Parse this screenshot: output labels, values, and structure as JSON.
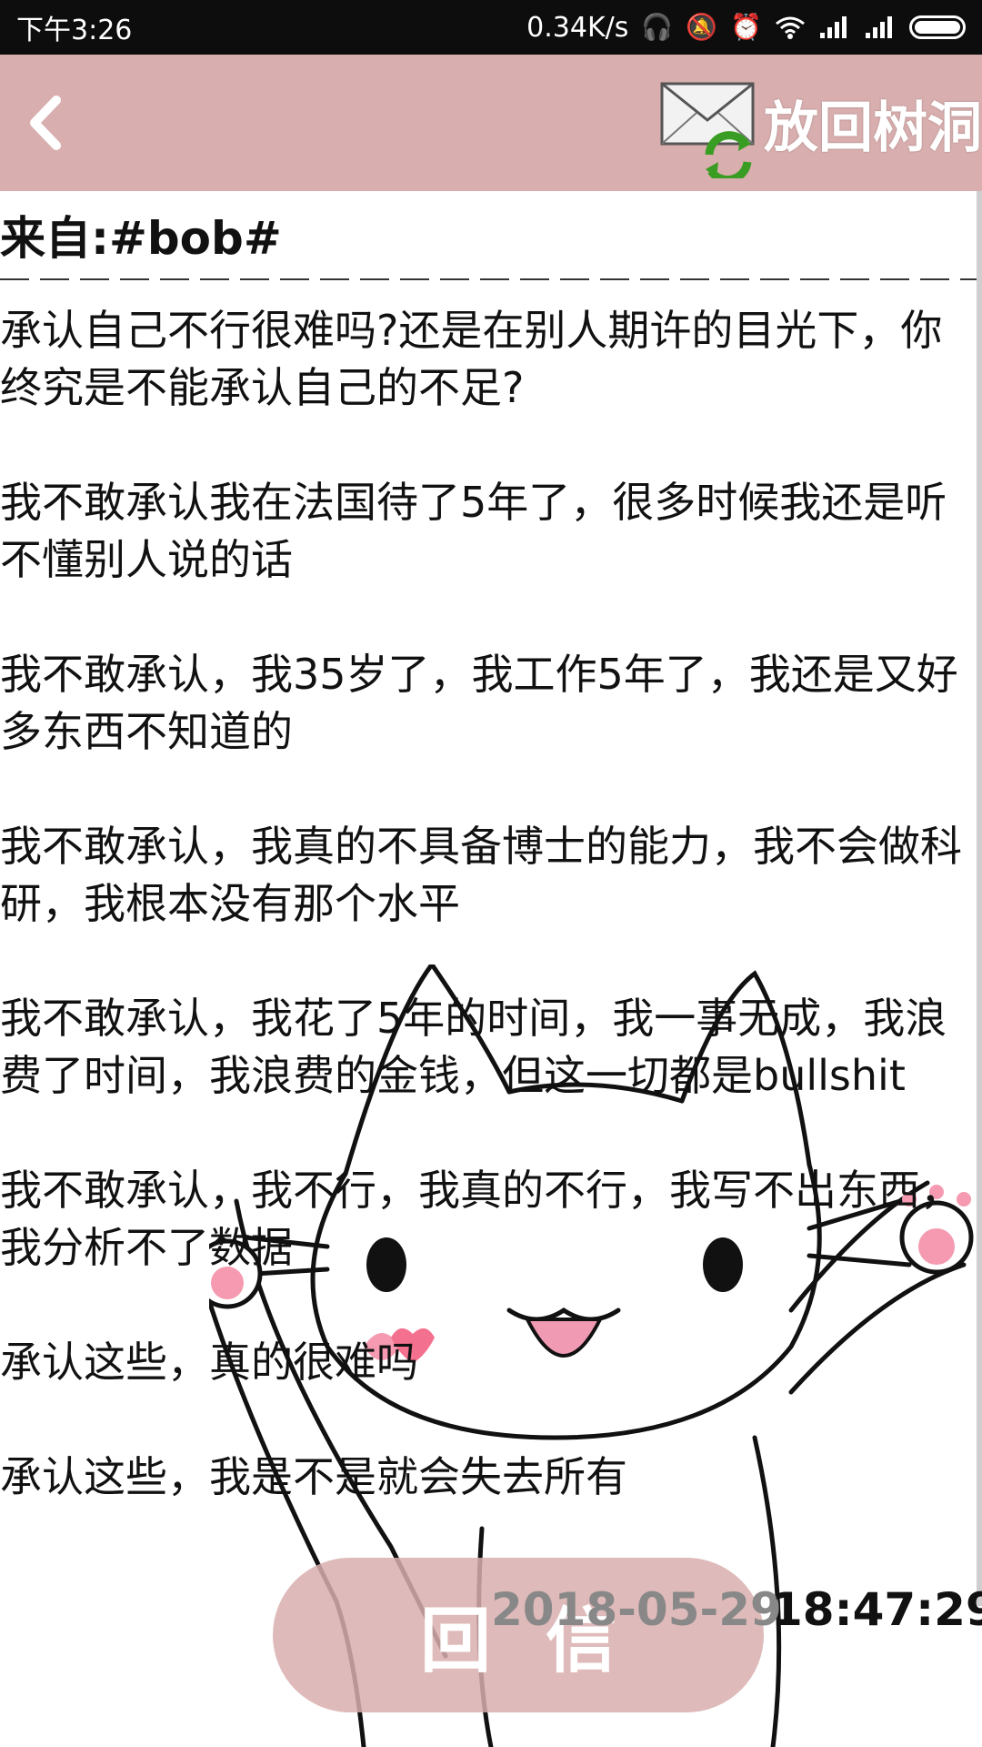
{
  "status_bar": {
    "time": "下午3:26",
    "network_speed": "0.34K/s",
    "icons": [
      "headphones-icon",
      "alarm-muted-icon",
      "alarm-clock-icon",
      "wifi-icon",
      "signal-icon",
      "signal-icon",
      "battery-icon"
    ]
  },
  "header": {
    "back_icon": "chevron-left-icon",
    "action_icon": "envelope-refresh-icon",
    "action_label": "放回树洞",
    "background": "#d9aeae"
  },
  "message": {
    "sender": "来自:#bob#",
    "paragraphs": [
      "承认自己不行很难吗?还是在别人期许的目光下，你终究是不能承认自己的不足?",
      "我不敢承认我在法国待了5年了，很多时候我还是听不懂别人说的话",
      "我不敢承认，我35岁了，我工作5年了，我还是又好多东西不知道的",
      "我不敢承认，我真的不具备博士的能力，我不会做科研，我根本没有那个水平",
      "我不敢承认，我花了5年的时间，我一事无成，我浪费了时间，我浪费的金钱，但这一切都是bullshit",
      "我不敢承认，我不行，我真的不行，我写不出东西，我分析不了数据",
      "承认这些，真的很难吗",
      "承认这些，我是不是就会失去所有"
    ],
    "date": "2018-05-29",
    "time": "18:47:29"
  },
  "reply_button": {
    "label": "回信"
  }
}
